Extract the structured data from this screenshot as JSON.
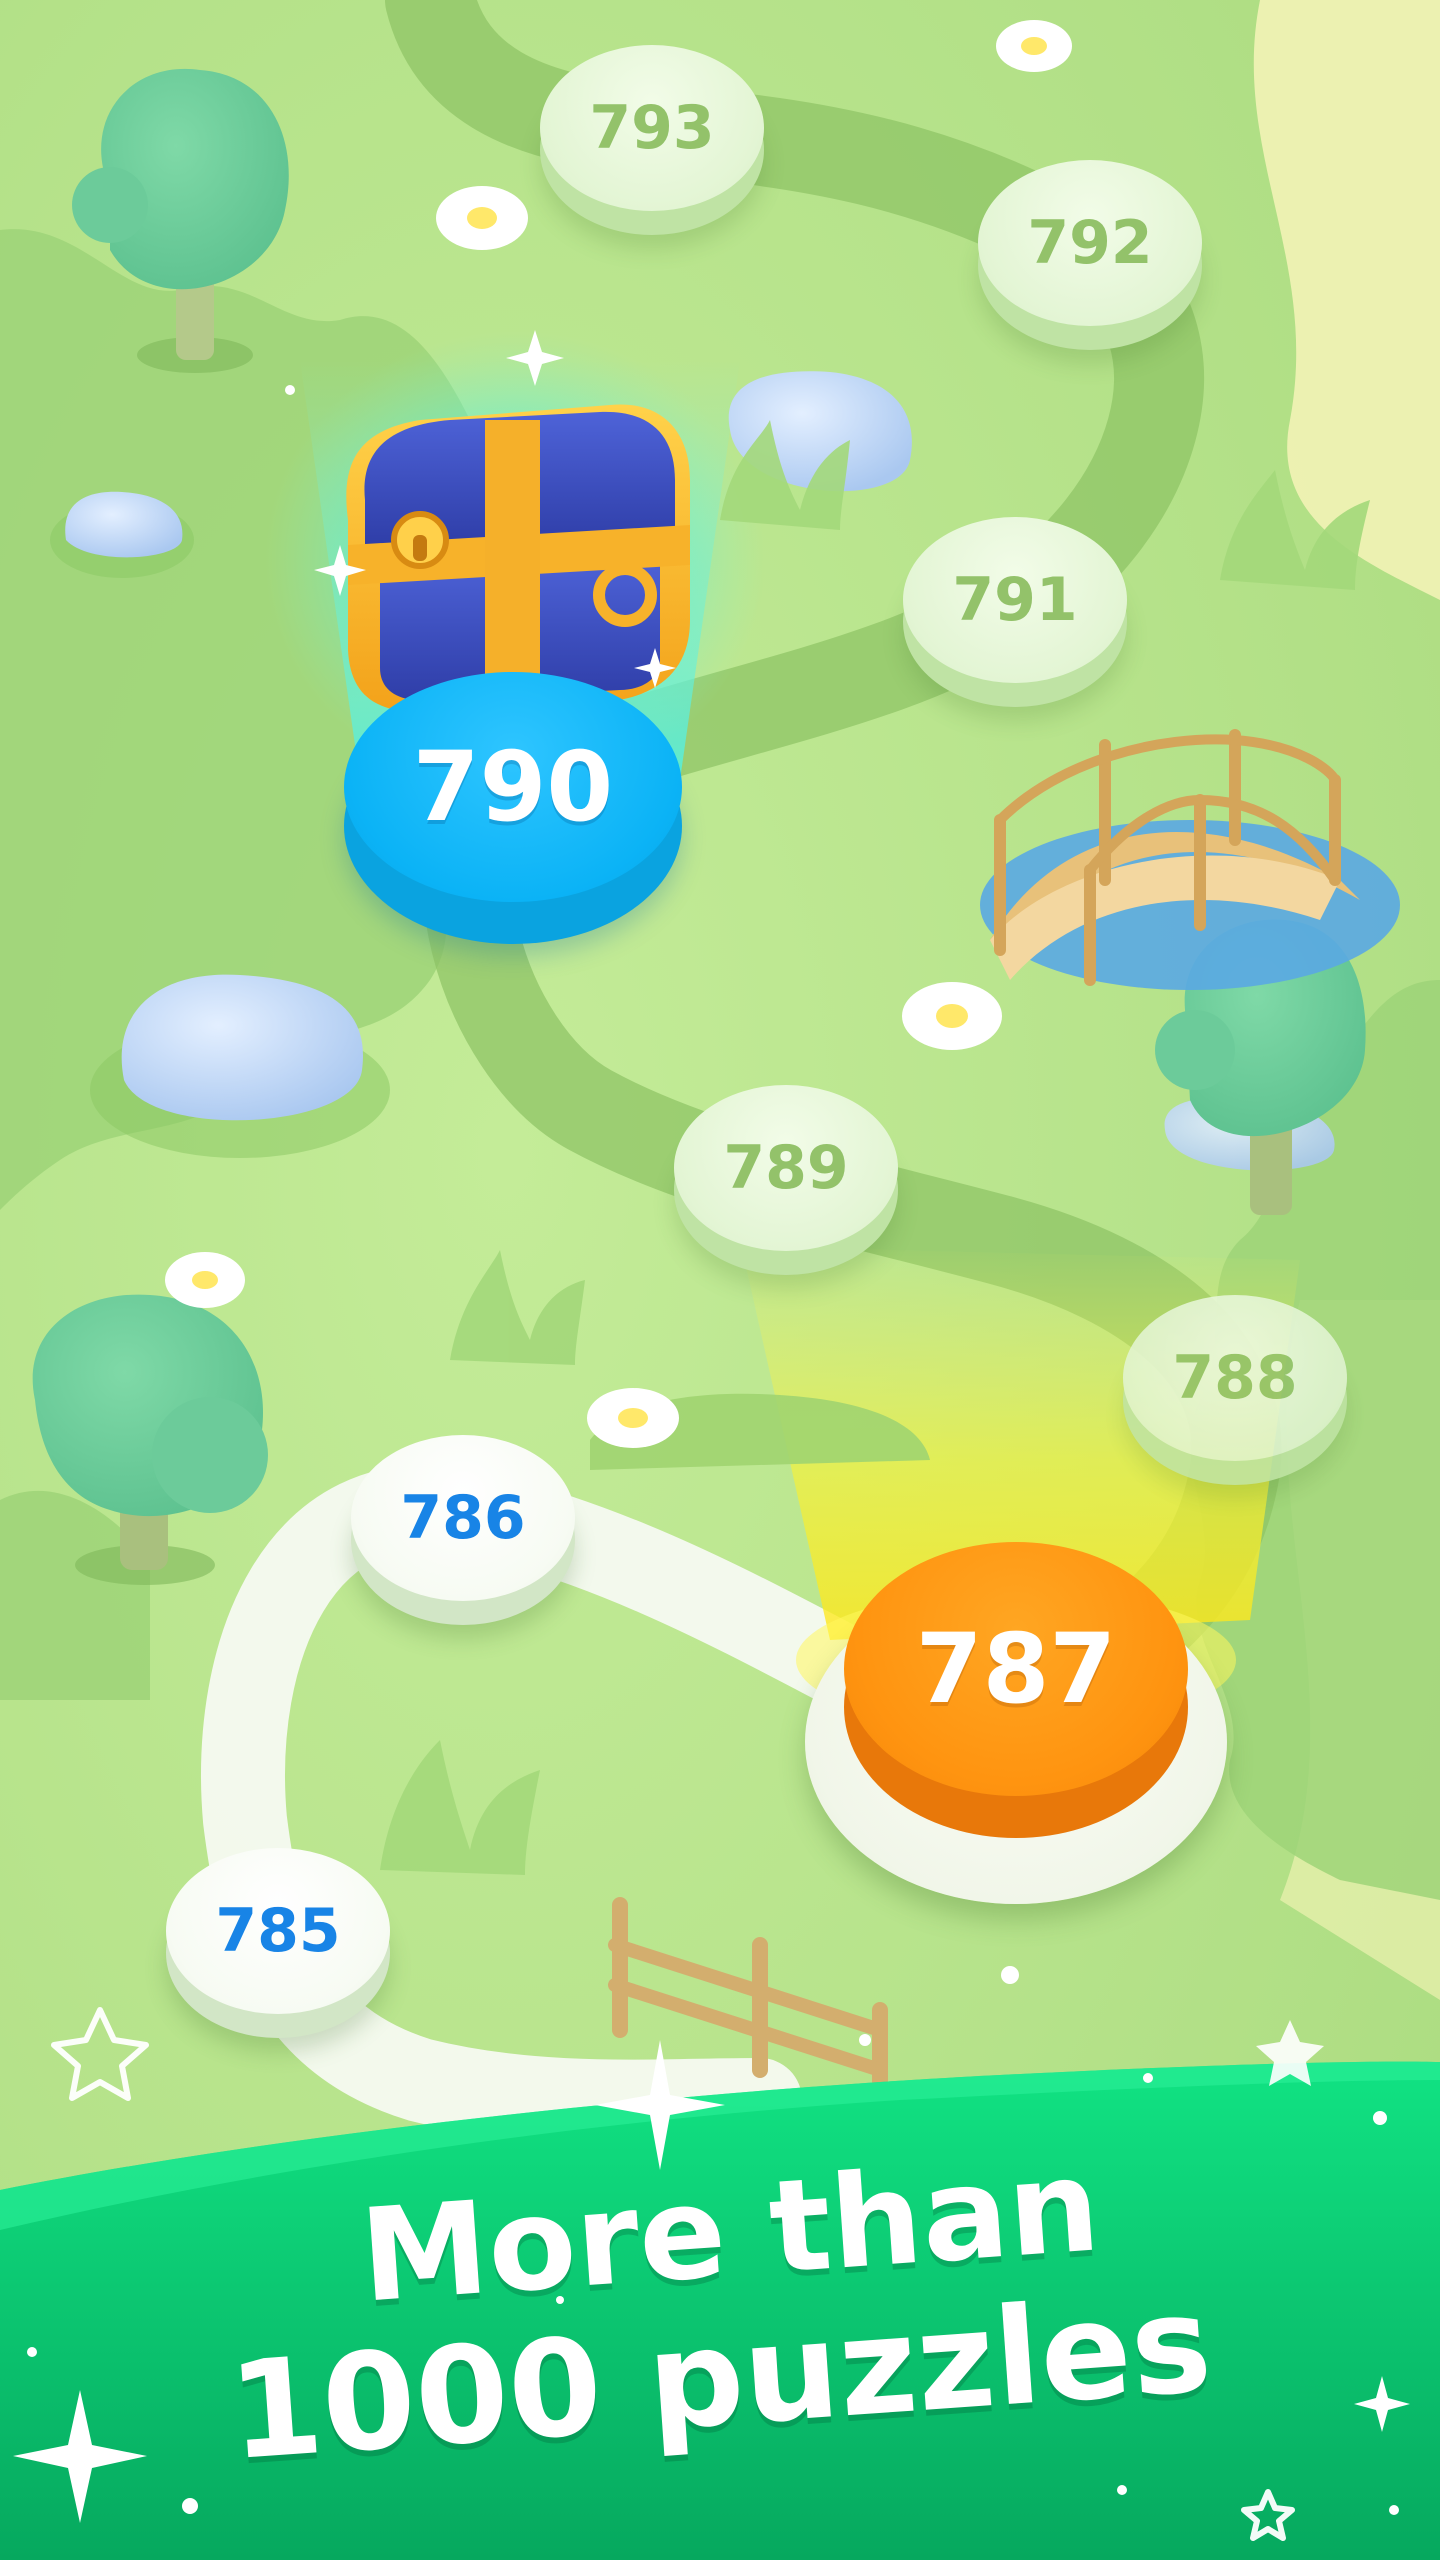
{
  "levels": {
    "l793": "793",
    "l792": "792",
    "l791": "791",
    "l790": "790",
    "l789": "789",
    "l788": "788",
    "l787": "787",
    "l786": "786",
    "l785": "785"
  },
  "current_level": "787",
  "reward_level": "790",
  "banner": {
    "line1": "More than",
    "line2": "1000 puzzles"
  },
  "colors": {
    "grass": "#b5e38c",
    "locked_text": "#93c26a",
    "completed_text": "#1884e6",
    "current_level": "#ff9410",
    "reward_level": "#0bb3f6",
    "banner_green": "#0cc36e"
  },
  "icons": [
    "treasure-chest-icon",
    "sparkle-icon",
    "star-icon",
    "tree-icon",
    "flower-icon",
    "bridge-icon",
    "fence-icon",
    "rock-icon"
  ]
}
